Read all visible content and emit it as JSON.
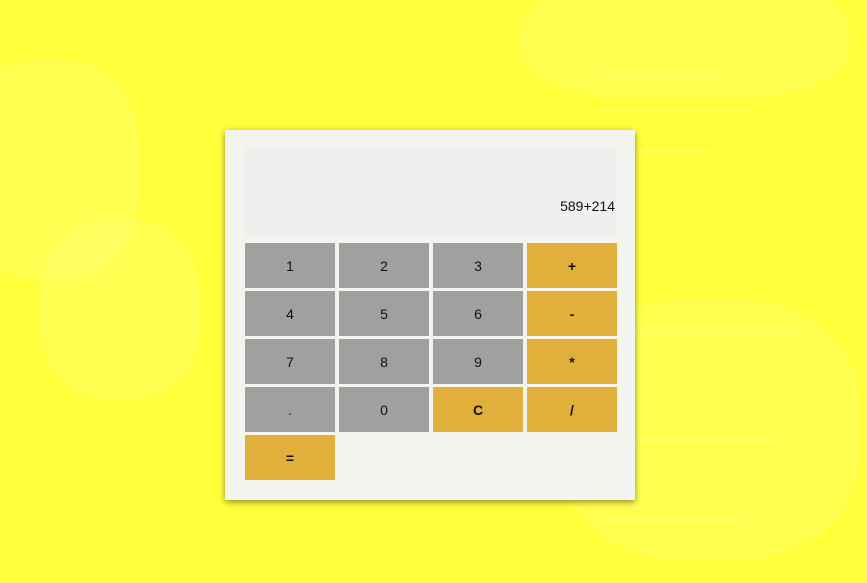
{
  "colors": {
    "background": "#ffff3c",
    "number_key": "#a0a0a0",
    "operator_key": "#e0b03a"
  },
  "display": {
    "value": "589+214"
  },
  "keys": {
    "k1": "1",
    "k2": "2",
    "k3": "3",
    "plus": "+",
    "k4": "4",
    "k5": "5",
    "k6": "6",
    "minus": "-",
    "k7": "7",
    "k8": "8",
    "k9": "9",
    "multiply": "*",
    "decimal": ".",
    "k0": "0",
    "clear": "C",
    "divide": "/",
    "equals": "="
  }
}
